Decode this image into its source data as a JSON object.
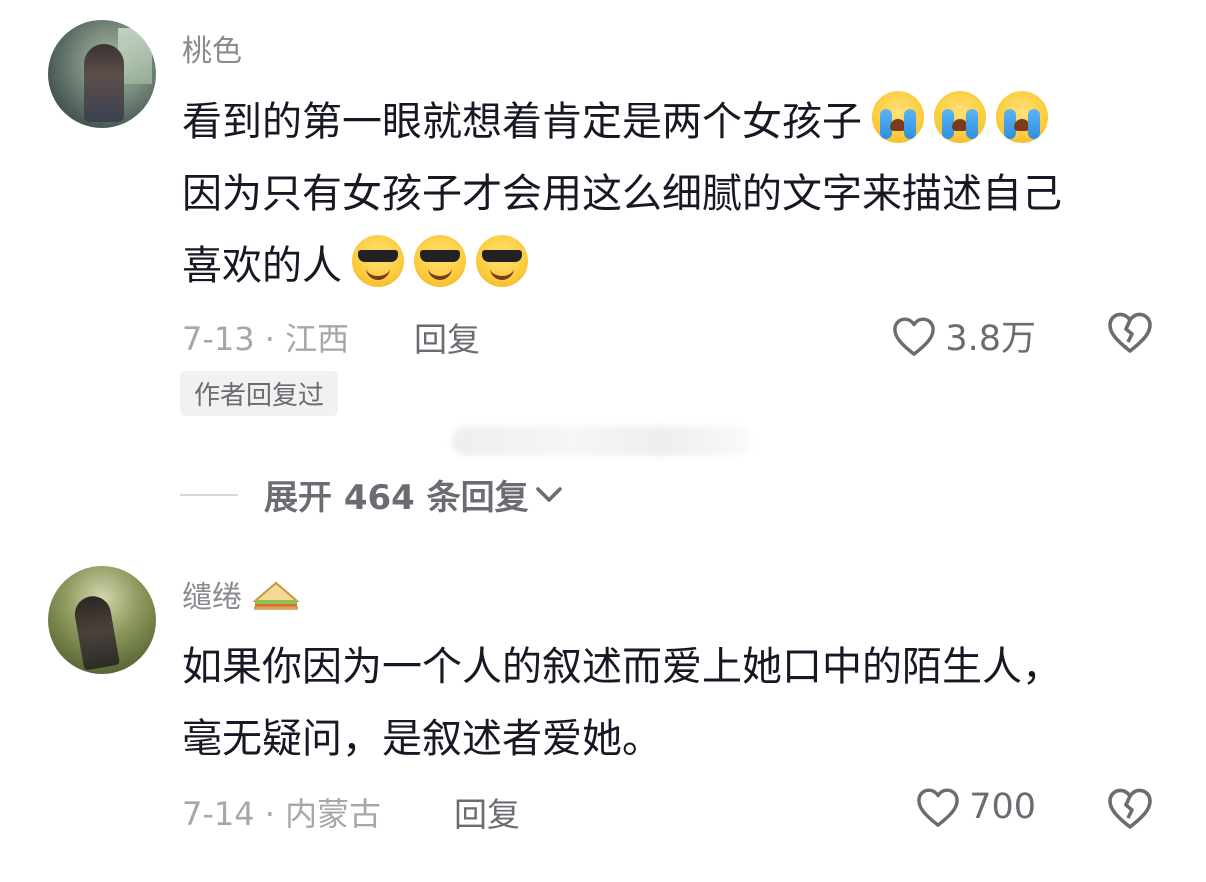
{
  "comments": [
    {
      "username": "桃色",
      "text_line1": "看到的第一眼就想着肯定是两个女孩子",
      "text_line2": "因为只有女孩子才会用这么细腻的文字来描述自己",
      "text_line3": "喜欢的人",
      "emojis_line1": [
        "loudly-crying-face-icon",
        "loudly-crying-face-icon",
        "loudly-crying-face-icon"
      ],
      "emojis_line3": [
        "sunglasses-face-icon",
        "sunglasses-face-icon",
        "sunglasses-face-icon"
      ],
      "date_location": "7-13 · 江西",
      "reply_label": "回复",
      "likes": "3.8万",
      "badge": "作者回复过",
      "expand_label": "展开 464 条回复"
    },
    {
      "username": "缱绻",
      "username_emoji": "sandwich-icon",
      "text_line1": "如果你因为一个人的叙述而爱上她口中的陌生人，",
      "text_line2": "毫无疑问，是叙述者爱她。",
      "date_location": "7-14 · 内蒙古",
      "reply_label": "回复",
      "likes": "700"
    }
  ],
  "colors": {
    "text_primary": "#161823",
    "text_secondary": "#8a8b91",
    "meta": "#a6a7ab",
    "badge_bg": "#f1f1f2"
  }
}
